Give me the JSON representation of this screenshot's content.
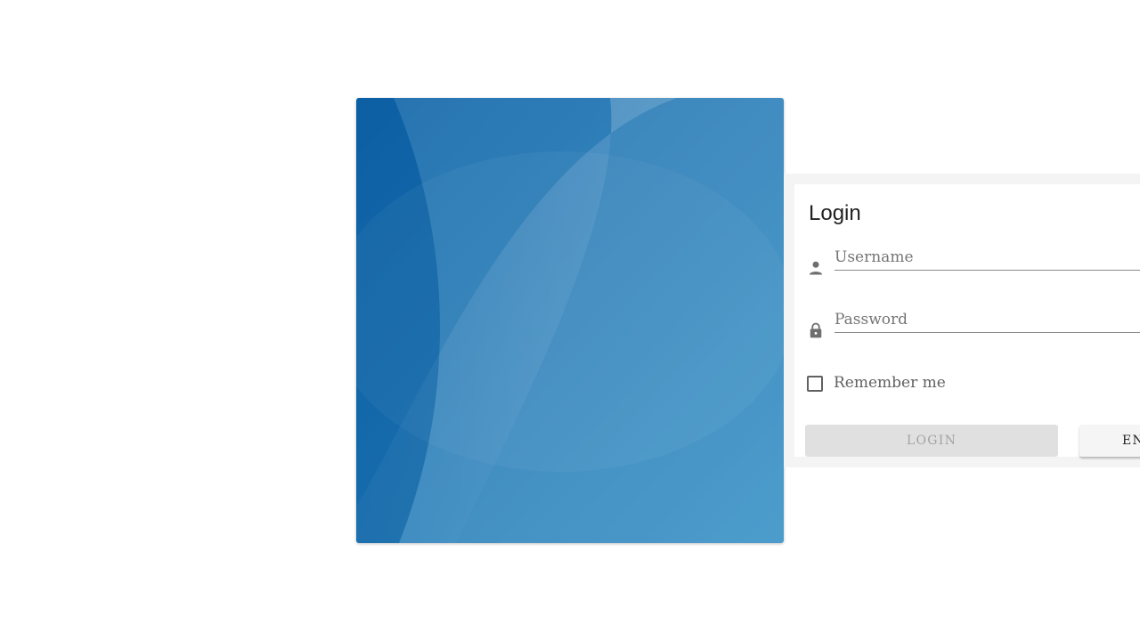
{
  "login": {
    "title": "Login",
    "username_placeholder": "Username",
    "password_placeholder": "Password",
    "remember_label": "Remember me",
    "login_button": "LOGIN",
    "secondary_button": "EN"
  },
  "icons": {
    "username": "person-icon",
    "password": "lock-icon",
    "remember": "checkbox-unchecked"
  },
  "colors": {
    "hero_dark": "#0e63a8",
    "hero_light": "#2a8ac2",
    "disabled_button": "#e0e0e0",
    "disabled_text": "#a3a3a3"
  }
}
